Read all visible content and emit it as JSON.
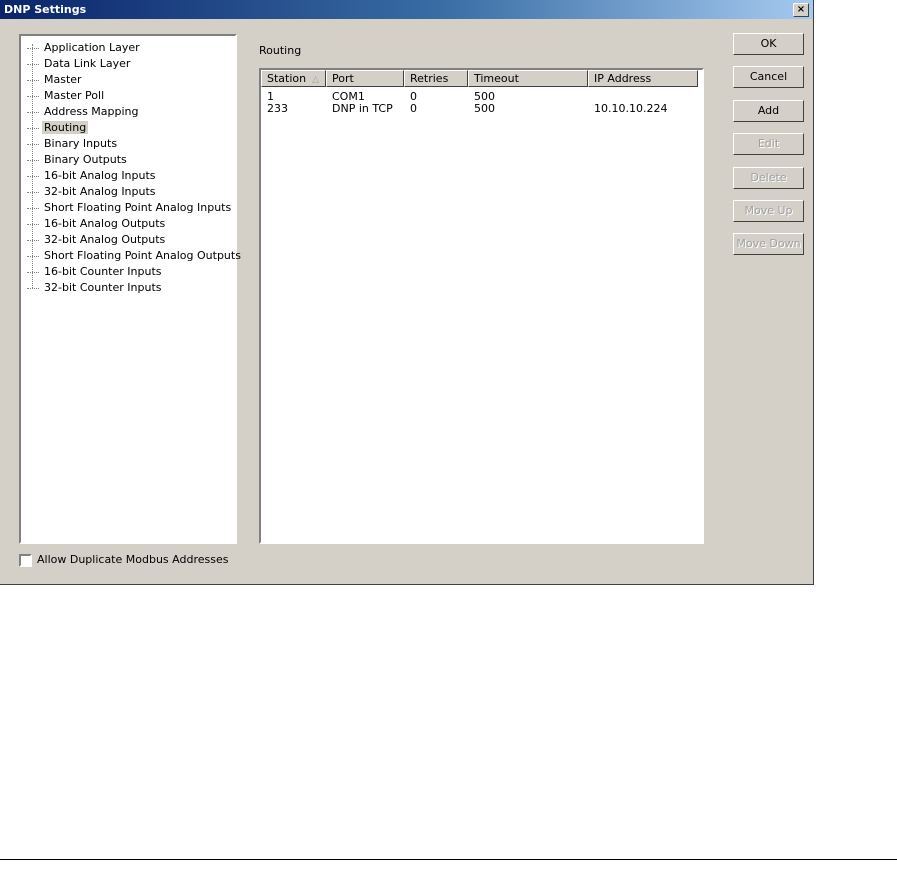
{
  "window": {
    "title": "DNP Settings",
    "close_label": "×"
  },
  "tree": {
    "items": [
      {
        "label": "Application Layer"
      },
      {
        "label": "Data Link Layer"
      },
      {
        "label": "Master"
      },
      {
        "label": "Master Poll"
      },
      {
        "label": "Address Mapping"
      },
      {
        "label": "Routing",
        "selected": true
      },
      {
        "label": "Binary Inputs"
      },
      {
        "label": "Binary Outputs"
      },
      {
        "label": "16-bit Analog Inputs"
      },
      {
        "label": "32-bit Analog Inputs"
      },
      {
        "label": "Short Floating Point Analog Inputs"
      },
      {
        "label": "16-bit Analog Outputs"
      },
      {
        "label": "32-bit Analog Outputs"
      },
      {
        "label": "Short Floating Point Analog Outputs"
      },
      {
        "label": "16-bit Counter Inputs"
      },
      {
        "label": "32-bit Counter Inputs"
      }
    ]
  },
  "routing": {
    "section_label": "Routing",
    "columns": [
      "Station",
      "Port",
      "Retries",
      "Timeout",
      "IP Address"
    ],
    "sort_indicator": "△",
    "rows": [
      [
        "1",
        "COM1",
        "0",
        "500",
        ""
      ],
      [
        "233",
        "DNP in TCP",
        "0",
        "500",
        "10.10.10.224"
      ]
    ]
  },
  "buttons": {
    "ok": "OK",
    "cancel": "Cancel",
    "add": "Add",
    "edit": "Edit",
    "delete": "Delete",
    "move_up": "Move Up",
    "move_down": "Move Down"
  },
  "options": {
    "allow_duplicate_label": "Allow Duplicate Modbus Addresses",
    "allow_duplicate_checked": false
  }
}
